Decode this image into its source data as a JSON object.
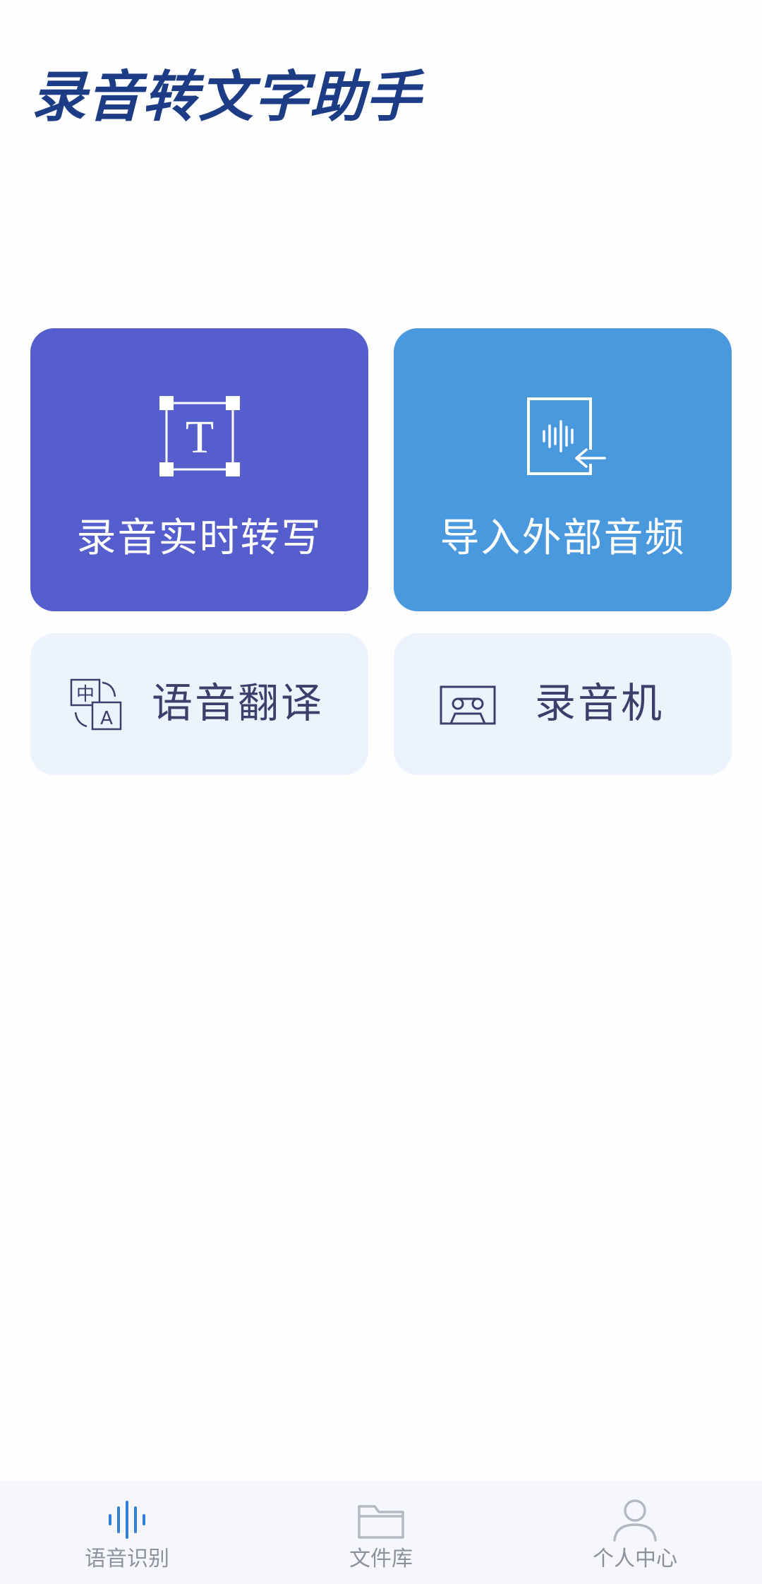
{
  "app": {
    "title": "录音转文字助手"
  },
  "features": {
    "realtime": {
      "label": "录音实时转写",
      "icon": "text-transcribe-icon",
      "color": "#565dcc"
    },
    "import_audio": {
      "label": "导入外部音频",
      "icon": "audio-import-icon",
      "color": "#4a98de"
    },
    "translate": {
      "label": "语音翻译",
      "icon": "translate-icon",
      "icon_text_zh": "中",
      "icon_text_en": "A"
    },
    "recorder": {
      "label": "录音机",
      "icon": "cassette-icon"
    }
  },
  "tabbar": {
    "active_index": 0,
    "active_color": "#2f80d6",
    "inactive_color": "#b4b8c2",
    "tabs": [
      {
        "label": "语音识别",
        "icon": "waveform-icon"
      },
      {
        "label": "文件库",
        "icon": "folder-icon"
      },
      {
        "label": "个人中心",
        "icon": "person-icon"
      }
    ]
  }
}
